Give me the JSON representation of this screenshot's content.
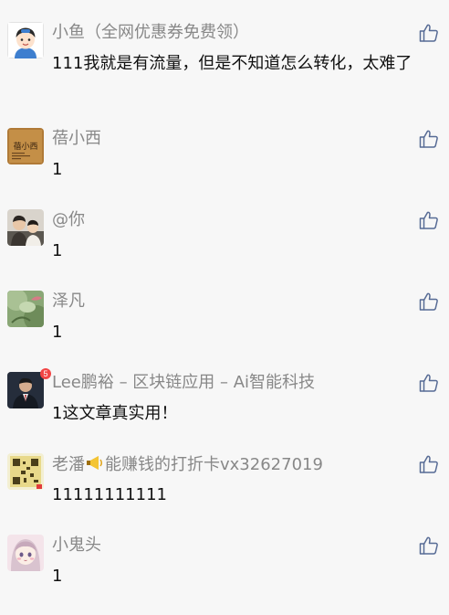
{
  "comments": [
    {
      "name": "小鱼（全网优惠券免费领）",
      "text": "111我就是有流量，但是不知道怎么转化，太难了",
      "avatar": "avatar-cartoon-boy"
    },
    {
      "name": "蓓小西",
      "text": "1",
      "avatar": "avatar-calligraphy",
      "avatar_text": "蓓小西"
    },
    {
      "name": "@你",
      "text": "1",
      "avatar": "avatar-photo-people"
    },
    {
      "name": "泽凡",
      "text": "1",
      "avatar": "avatar-photo-plant"
    },
    {
      "name": "Lee鹏裕 – 区块链应用 – Ai智能科技",
      "text": "1这文章真实用！",
      "avatar": "avatar-photo-man-suit",
      "badge": "5"
    },
    {
      "name_prefix": "老潘",
      "name_suffix": "能赚钱的打折卡vx32627019",
      "text": "11111111111",
      "avatar": "avatar-qr-pattern",
      "name_icon": "megaphone-icon"
    },
    {
      "name": "小鬼头",
      "text": "1",
      "avatar": "avatar-anime-girl"
    }
  ],
  "colors": {
    "background": "#f7f7f7",
    "name": "#888888",
    "text": "#111111",
    "like_icon": "#576b95",
    "badge": "#f24545"
  },
  "like_icon": "thumbs-up-icon"
}
